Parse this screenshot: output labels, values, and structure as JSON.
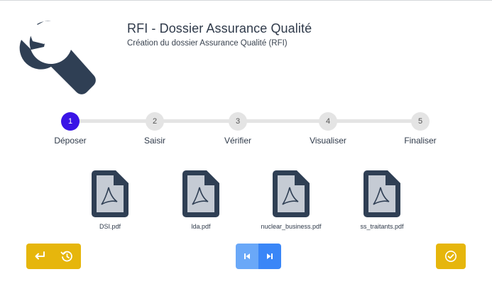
{
  "header": {
    "title": "RFI - Dossier Assurance Qualité",
    "subtitle": "Création du dossier Assurance Qualité (RFI)",
    "logo_icon": "wrench-icon"
  },
  "stepper": {
    "active_step": 1,
    "steps": [
      {
        "number": "1",
        "label": "Déposer"
      },
      {
        "number": "2",
        "label": "Saisir"
      },
      {
        "number": "3",
        "label": "Vérifier"
      },
      {
        "number": "4",
        "label": "Visualiser"
      },
      {
        "number": "5",
        "label": "Finaliser"
      }
    ]
  },
  "files": [
    {
      "name": "DSI.pdf",
      "icon": "pdf-file-icon"
    },
    {
      "name": "lda.pdf",
      "icon": "pdf-file-icon"
    },
    {
      "name": "nuclear_business.pdf",
      "icon": "pdf-file-icon"
    },
    {
      "name": "ss_traitants.pdf",
      "icon": "pdf-file-icon"
    }
  ],
  "buttons": {
    "back_icon": "return-arrow-icon",
    "reset_icon": "history-reset-icon",
    "first_icon": "skip-to-start-icon",
    "last_icon": "skip-to-end-icon",
    "validate_icon": "check-circle-icon"
  },
  "colors": {
    "accent_active_step": "#3a14e6",
    "button_yellow": "#e6b60c",
    "button_blue_light": "#6aa8f8",
    "button_blue": "#3a86f7",
    "icon_dark": "#2f3f54"
  }
}
